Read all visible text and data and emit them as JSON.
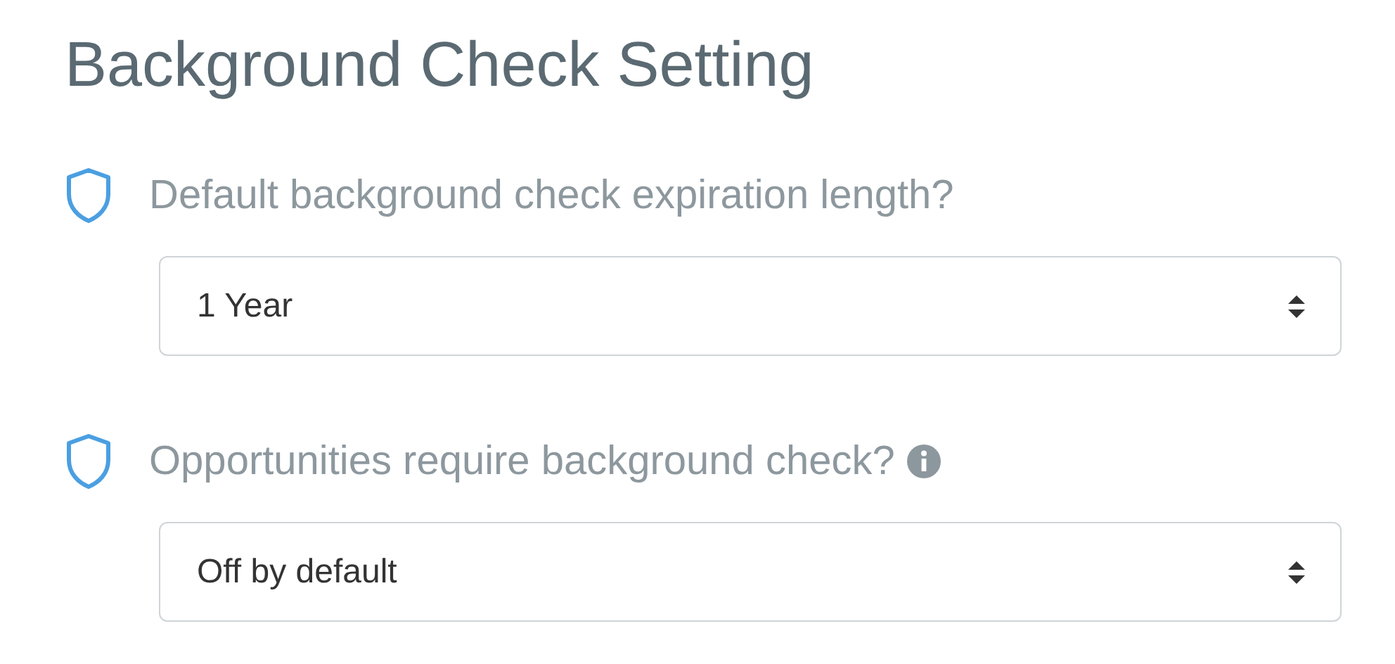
{
  "title": "Background Check Setting",
  "settings": [
    {
      "question": "Default background check expiration length?",
      "info": false,
      "value": "1 Year"
    },
    {
      "question": "Opportunities require background check?",
      "info": true,
      "value": "Off by default"
    }
  ]
}
